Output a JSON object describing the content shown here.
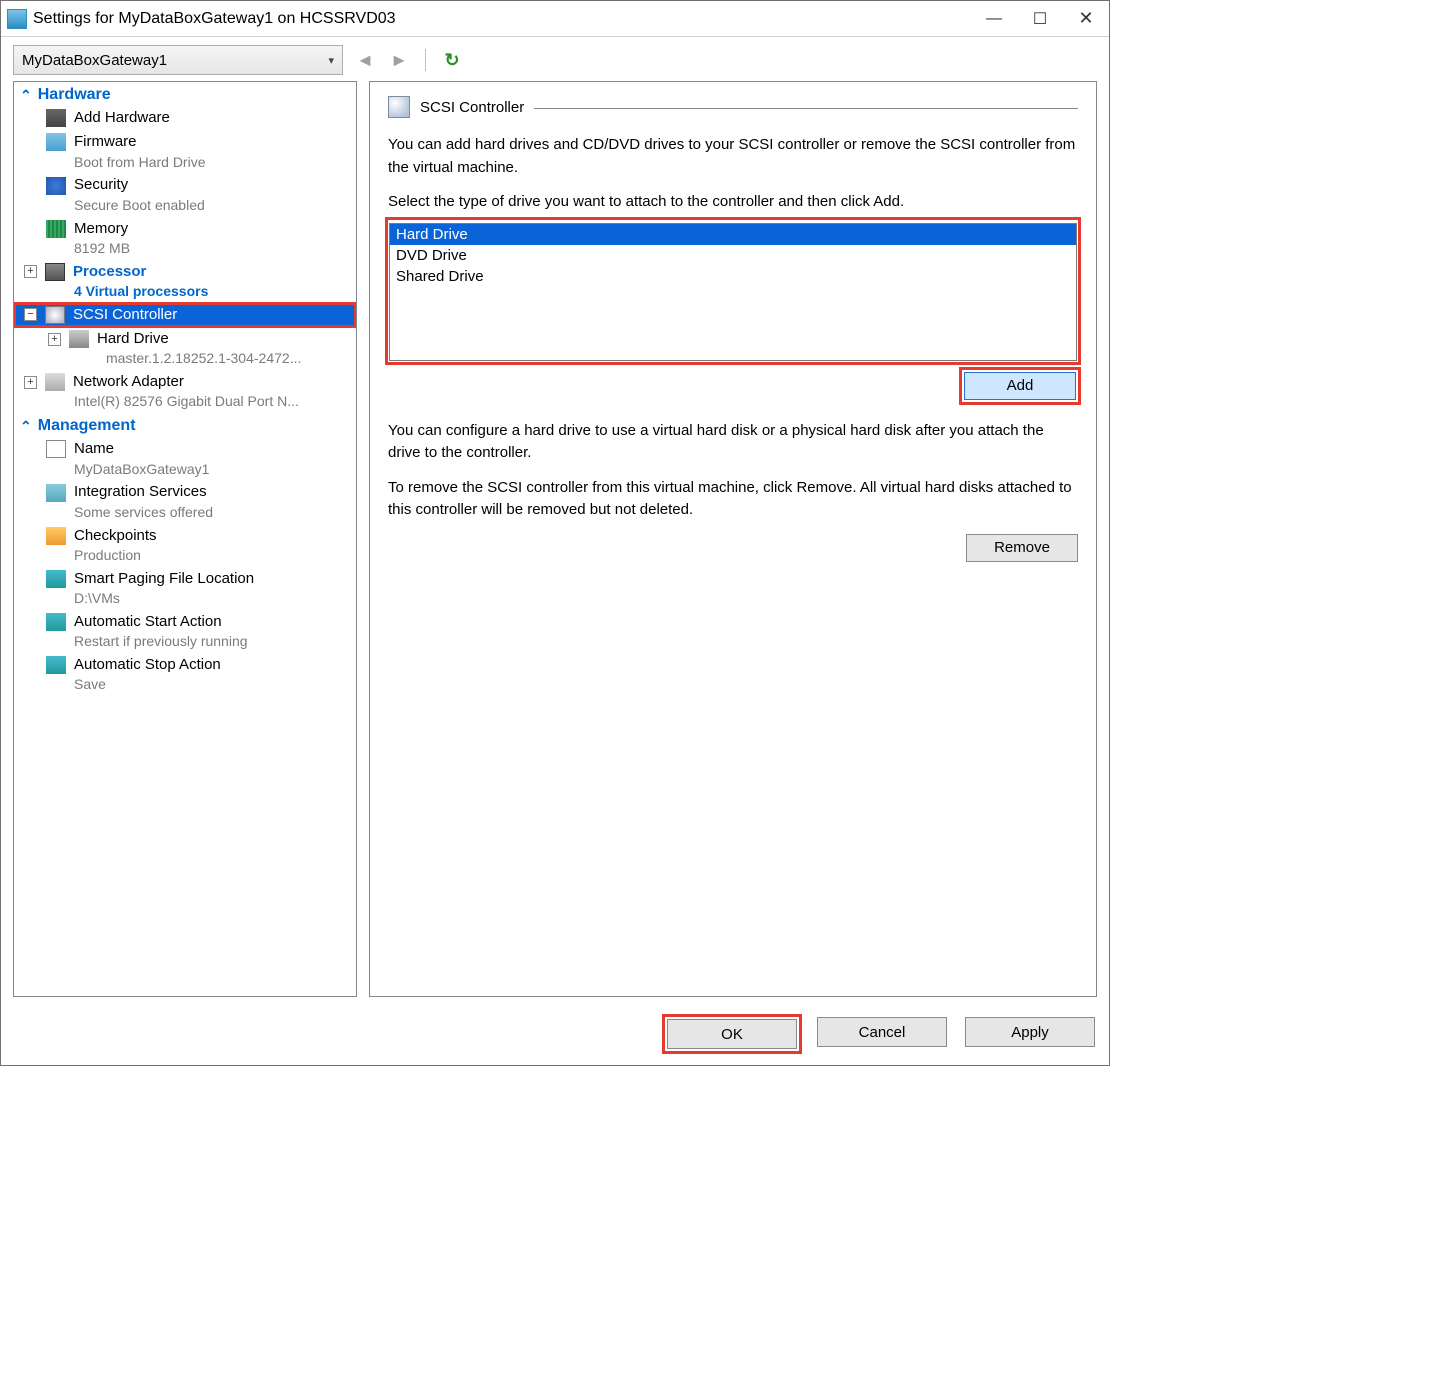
{
  "window": {
    "title": "Settings for MyDataBoxGateway1 on HCSSRVD03"
  },
  "vm_selector": {
    "value": "MyDataBoxGateway1"
  },
  "tree": {
    "hardware_header": "Hardware",
    "management_header": "Management",
    "items": {
      "add_hardware": {
        "label": "Add Hardware"
      },
      "firmware": {
        "label": "Firmware",
        "sub": "Boot from Hard Drive"
      },
      "security": {
        "label": "Security",
        "sub": "Secure Boot enabled"
      },
      "memory": {
        "label": "Memory",
        "sub": "8192 MB"
      },
      "processor": {
        "label": "Processor",
        "sub": "4 Virtual processors"
      },
      "scsi": {
        "label": "SCSI Controller"
      },
      "hard_drive": {
        "label": "Hard Drive",
        "sub": "master.1.2.18252.1-304-2472..."
      },
      "network": {
        "label": "Network Adapter",
        "sub": "Intel(R) 82576 Gigabit Dual Port N..."
      },
      "name": {
        "label": "Name",
        "sub": "MyDataBoxGateway1"
      },
      "integration": {
        "label": "Integration Services",
        "sub": "Some services offered"
      },
      "checkpoints": {
        "label": "Checkpoints",
        "sub": "Production"
      },
      "paging": {
        "label": "Smart Paging File Location",
        "sub": "D:\\VMs"
      },
      "auto_start": {
        "label": "Automatic Start Action",
        "sub": "Restart if previously running"
      },
      "auto_stop": {
        "label": "Automatic Stop Action",
        "sub": "Save"
      }
    }
  },
  "detail": {
    "title": "SCSI Controller",
    "desc1": "You can add hard drives and CD/DVD drives to your SCSI controller or remove the SCSI controller from the virtual machine.",
    "desc2": "Select the type of drive you want to attach to the controller and then click Add.",
    "options": {
      "0": "Hard Drive",
      "1": "DVD Drive",
      "2": "Shared Drive"
    },
    "add_label": "Add",
    "desc3": "You can configure a hard drive to use a virtual hard disk or a physical hard disk after you attach the drive to the controller.",
    "desc4": "To remove the SCSI controller from this virtual machine, click Remove. All virtual hard disks attached to this controller will be removed but not deleted.",
    "remove_label": "Remove"
  },
  "footer": {
    "ok": "OK",
    "cancel": "Cancel",
    "apply": "Apply"
  }
}
